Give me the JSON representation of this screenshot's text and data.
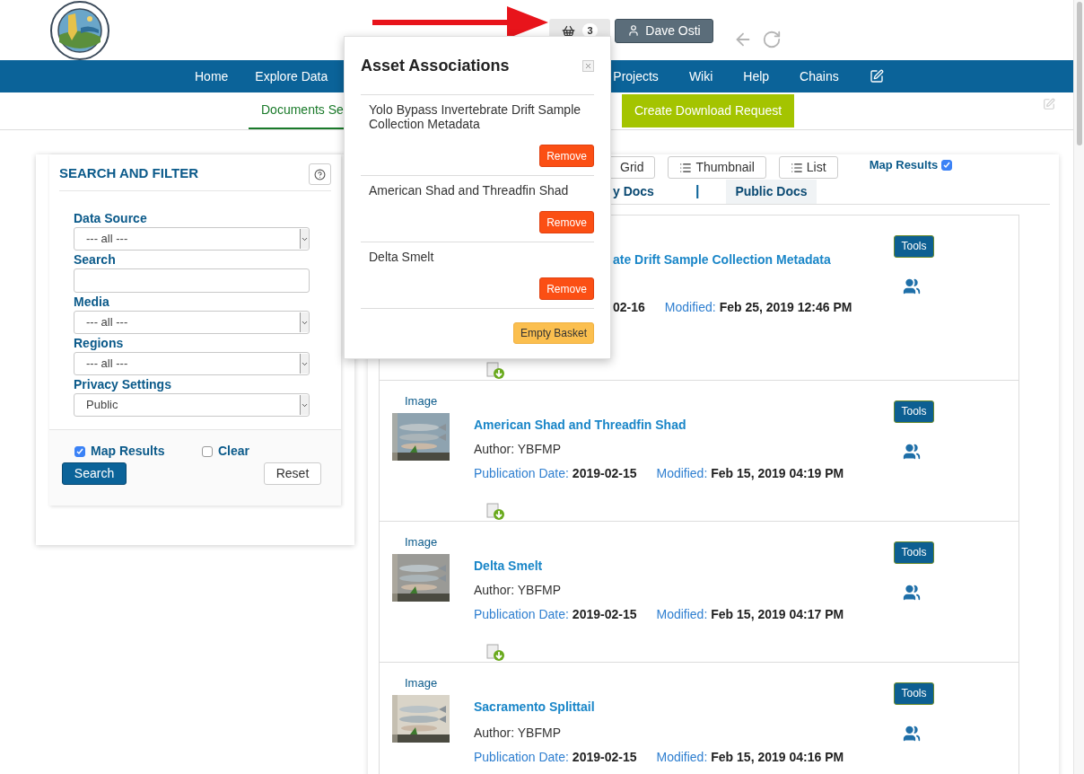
{
  "header": {
    "basket": {
      "count": "3"
    },
    "user": {
      "name": "Dave Osti"
    }
  },
  "nav": {
    "left_items": [
      "Home",
      "Explore Data"
    ],
    "right_items": [
      "Projects",
      "Wiki",
      "Help",
      "Chains"
    ]
  },
  "subnav": {
    "tabs": [
      {
        "label": "Documents Se",
        "selected": true
      }
    ],
    "download_button": "Create Download Request"
  },
  "filter": {
    "title": "SEARCH AND FILTER",
    "fields": [
      {
        "label": "Data Source",
        "kind": "select",
        "value": "--- all ---"
      },
      {
        "label": "Search",
        "kind": "text"
      },
      {
        "label": "Media",
        "kind": "select",
        "value": "--- all ---"
      },
      {
        "label": "Regions",
        "kind": "select",
        "value": "--- all ---"
      },
      {
        "label": "Privacy Settings",
        "kind": "select",
        "value": "Public"
      }
    ],
    "checkboxes": [
      {
        "label": "Map Results",
        "checked": true
      },
      {
        "label": "Clear",
        "checked": false
      }
    ],
    "search_button": "Search",
    "reset_button": "Reset"
  },
  "results": {
    "views": [
      {
        "label": "Grid",
        "selected": false
      },
      {
        "label": "Thumbnail",
        "selected": false
      },
      {
        "label": "List",
        "selected": false
      }
    ],
    "map_results": {
      "label": "Map Results",
      "checked": true
    },
    "doc_tabs": [
      {
        "label": "y Docs",
        "selected": false
      },
      {
        "label": "Public Docs",
        "selected": true
      }
    ],
    "separator": "|",
    "items": [
      {
        "title": "ate Drift Sample Collection Metadata",
        "pub_date": "02-16",
        "modified_label": "Modified:",
        "modified": "Feb 25, 2019 12:46 PM",
        "tools": "Tools",
        "download": true
      },
      {
        "media": "Image",
        "title": "American Shad and Threadfin Shad",
        "author": "Author: YBFMP",
        "pub_label": "Publication Date:",
        "pub_date": "2019-02-15",
        "modified_label": "Modified:",
        "modified": "Feb 15, 2019 04:19 PM",
        "tools": "Tools",
        "download": true
      },
      {
        "media": "Image",
        "title": "Delta Smelt",
        "author": "Author: YBFMP",
        "pub_label": "Publication Date:",
        "pub_date": "2019-02-15",
        "modified_label": "Modified:",
        "modified": "Feb 15, 2019 04:17 PM",
        "tools": "Tools",
        "download": true
      },
      {
        "media": "Image",
        "title": "Sacramento Splittail",
        "author": "Author: YBFMP",
        "pub_label": "Publication Date:",
        "pub_date": "2019-02-15",
        "modified_label": "Modified:",
        "modified": "Feb 15, 2019 04:16 PM",
        "tools": "Tools"
      }
    ]
  },
  "basket_popover": {
    "title": "Asset Associations",
    "items": [
      {
        "name": "Yolo Bypass Invertebrate Drift Sample Collection Metadata",
        "action": "Remove"
      },
      {
        "name": "American Shad and Threadfin Shad",
        "action": "Remove"
      },
      {
        "name": "Delta Smelt",
        "action": "Remove"
      }
    ],
    "empty_button": "Empty Basket"
  }
}
